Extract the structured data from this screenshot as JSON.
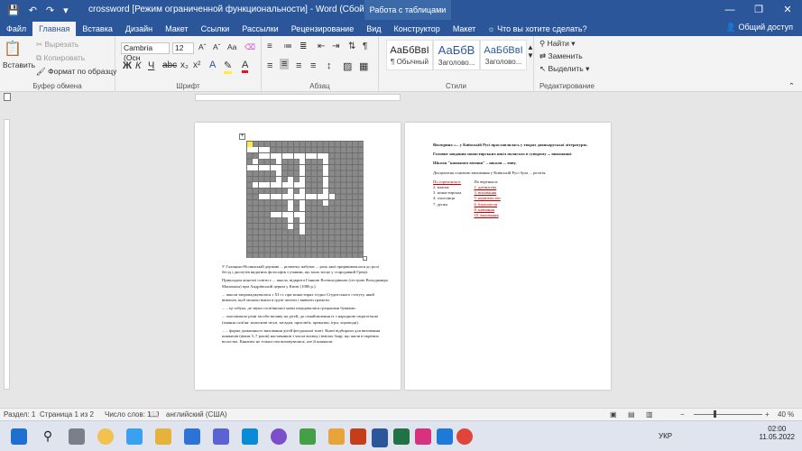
{
  "titlebar": {
    "title": "crossword [Режим ограниченной функциональности] - Word (Сбой активац...",
    "context_tab": "Работа с таблицами",
    "minimize": "—",
    "restore": "❐",
    "close": "✕"
  },
  "tabs": [
    "Файл",
    "Главная",
    "Вставка",
    "Дизайн",
    "Макет",
    "Ссылки",
    "Рассылки",
    "Рецензирование",
    "Вид",
    "Конструктор",
    "Макет"
  ],
  "tell_me": "Что вы хотите сделать?",
  "share": "Общий доступ",
  "ribbon": {
    "clipboard": {
      "paste": "Вставить",
      "cut": "Вырезать",
      "copy": "Копировать",
      "format_painter": "Формат по образцу",
      "label": "Буфер обмена"
    },
    "font": {
      "name": "Cambria (Осн",
      "size": "12",
      "bold": "Ж",
      "italic": "К",
      "underline": "Ч",
      "label": "Шрифт"
    },
    "paragraph": {
      "label": "Абзац"
    },
    "styles": {
      "items": [
        {
          "sample": "АаБбВвI",
          "name": "¶ Обычный"
        },
        {
          "sample": "АаБбВ",
          "name": "Заголово..."
        },
        {
          "sample": "АаБбВвI",
          "name": "Заголово..."
        }
      ],
      "label": "Стили"
    },
    "editing": {
      "find": "Найти",
      "replace": "Заменить",
      "select": "Выделить",
      "label": "Редактирование"
    }
  },
  "page1": {
    "paragraphs": [
      "У Галицько-Волинській державі ... розвитку набуває ... роль якої прирівнювалася до ролі бесід і диспутів видатних філософів з учнями, що мало місце у стародавній Греції.",
      "Прикладом жіночої освіти є ... школа, відкрита Ганною Всеволодівною (сестрою Володимира Мономаха) при Андріївській церкві у Києві (1086 р.).",
      "... школи запроваджувалися з XI ст. при монастирях згідно Студитського статуту, який вимагав, щоб монахи вміли в групі читати і вивчати грамоти.",
      "... – це азбука, де звуки слов'янської мови передавалися грецькими буквами.",
      "... охоплювало різні засоби впливу на дітей, до ознайомлення їх з народною педагогікою (знання слів'ян: колискові пісні, загадки, прислів'я, приказки, ігри, хороводи).",
      "... – форма домашнього виховання дітей феодальної знаті. Князі відбирали для виховання княжичів (віком 5–7 років) наставників з числа воєвод і вмілих бояр, що жили в окремих волостях. Княжичі не тільки там виховувалися, але й княжили."
    ]
  },
  "page2": {
    "title": "Вікторина «... у Київській Русі прославлялась у творах давньоруської літератури»",
    "line1": "Головне завдання монастирських шкіл полягало в суворому ... виконанні.",
    "line2": "Школи \"книжного вчення\" – школи ... типу.",
    "line3": "Дисципліна основою виховання у Київській Русі була ... релігія.",
    "col_left_header": "По горизонталі:",
    "col_right_header": "По вертикалі:",
    "col_left": [
      "2. власна",
      "3. монастирська",
      "4. глаголиця",
      "7. дупка"
    ],
    "col_right": [
      "1. дитинство",
      "3. виховання",
      "5. кормильство",
      "6. благочестя",
      "8. навчання",
      "10. виховання"
    ]
  },
  "status": {
    "section": "Раздел: 1",
    "page": "Страница 1 из 2",
    "words": "Число слов: 199",
    "language": "английский (США)",
    "zoom": "40 %"
  },
  "taskbar": {
    "lang": "УКР",
    "time": "02:00",
    "date": "11.05.2022"
  }
}
